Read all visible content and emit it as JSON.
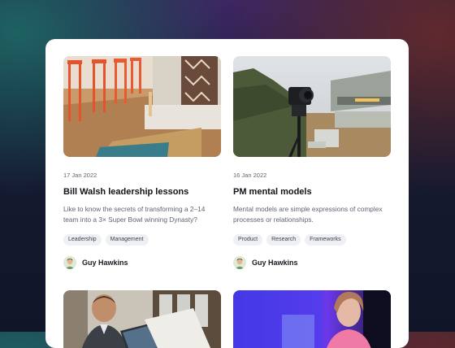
{
  "posts": [
    {
      "date": "17 Jan 2022",
      "title": "Bill Walsh leadership lessons",
      "description": "Like to know the secrets of transforming a 2–14 team into a 3× Super Bowl winning Dynasty?",
      "tags": [
        "Leadership",
        "Management"
      ],
      "author": "Guy Hawkins"
    },
    {
      "date": "16 Jan 2022",
      "title": "PM mental models",
      "description": "Mental models are simple expressions of complex processes or relationships.",
      "tags": [
        "Product",
        "Research",
        "Frameworks"
      ],
      "author": "Guy Hawkins"
    }
  ],
  "colors": {
    "card": "#ffffff",
    "tag_bg": "#eef0f3",
    "title": "#111318",
    "muted": "#5f6470"
  }
}
